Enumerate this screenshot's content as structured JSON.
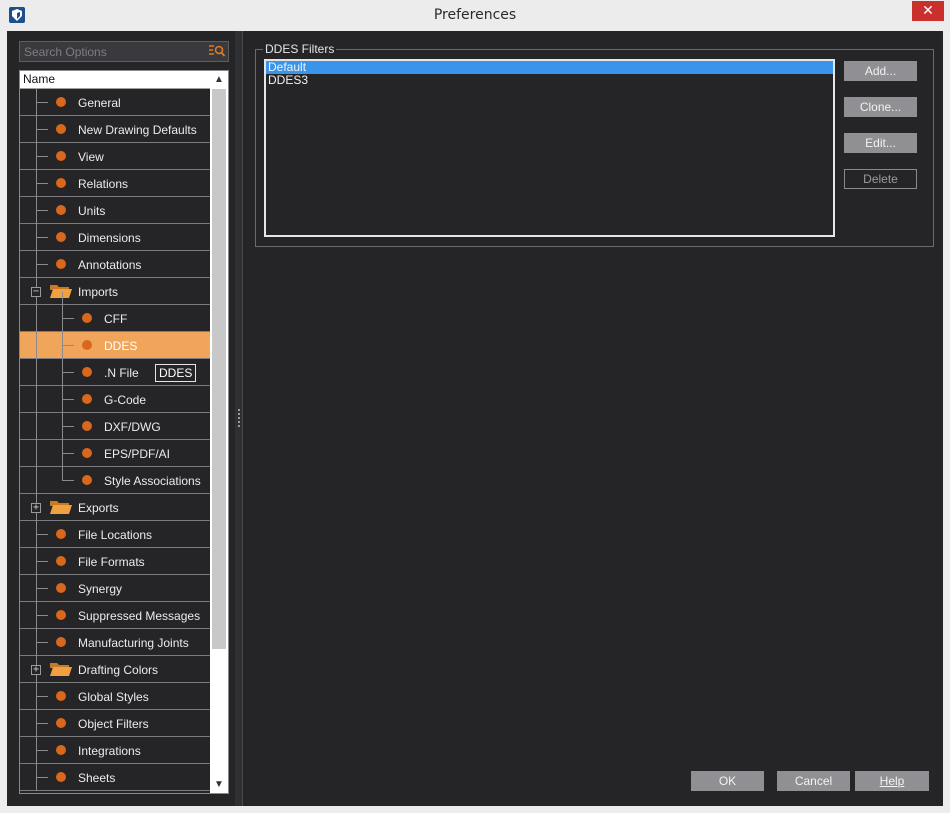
{
  "window": {
    "title": "Preferences",
    "close_glyph": "✕"
  },
  "search": {
    "placeholder": "Search Options",
    "icon": "search-filter-icon"
  },
  "tree": {
    "header": "Name",
    "items": [
      {
        "label": "General",
        "level": 1,
        "kind": "leaf"
      },
      {
        "label": "New Drawing Defaults",
        "level": 1,
        "kind": "leaf"
      },
      {
        "label": "View",
        "level": 1,
        "kind": "leaf"
      },
      {
        "label": "Relations",
        "level": 1,
        "kind": "leaf"
      },
      {
        "label": "Units",
        "level": 1,
        "kind": "leaf"
      },
      {
        "label": "Dimensions",
        "level": 1,
        "kind": "leaf"
      },
      {
        "label": "Annotations",
        "level": 1,
        "kind": "leaf"
      },
      {
        "label": "Imports",
        "level": 1,
        "kind": "folder",
        "expanded": true
      },
      {
        "label": "CFF",
        "level": 2,
        "kind": "leaf"
      },
      {
        "label": "DDES",
        "level": 2,
        "kind": "leaf",
        "selected": true
      },
      {
        "label": ".N File",
        "level": 2,
        "kind": "leaf"
      },
      {
        "label": "G-Code",
        "level": 2,
        "kind": "leaf"
      },
      {
        "label": "DXF/DWG",
        "level": 2,
        "kind": "leaf"
      },
      {
        "label": "EPS/PDF/AI",
        "level": 2,
        "kind": "leaf"
      },
      {
        "label": "Style Associations",
        "level": 2,
        "kind": "leaf",
        "last": true
      },
      {
        "label": "Exports",
        "level": 1,
        "kind": "folder",
        "expanded": false
      },
      {
        "label": "File Locations",
        "level": 1,
        "kind": "leaf"
      },
      {
        "label": "File Formats",
        "level": 1,
        "kind": "leaf"
      },
      {
        "label": "Synergy",
        "level": 1,
        "kind": "leaf"
      },
      {
        "label": "Suppressed Messages",
        "level": 1,
        "kind": "leaf"
      },
      {
        "label": "Manufacturing Joints",
        "level": 1,
        "kind": "leaf"
      },
      {
        "label": "Drafting Colors",
        "level": 1,
        "kind": "folder",
        "expanded": false
      },
      {
        "label": "Global Styles",
        "level": 1,
        "kind": "leaf"
      },
      {
        "label": "Object Filters",
        "level": 1,
        "kind": "leaf"
      },
      {
        "label": "Integrations",
        "level": 1,
        "kind": "leaf"
      },
      {
        "label": "Sheets",
        "level": 1,
        "kind": "leaf"
      }
    ],
    "tooltip": "DDES"
  },
  "ddes_filters": {
    "group_title": "DDES Filters",
    "items": [
      "Default",
      "DDES3"
    ],
    "selected_index": 0,
    "buttons": {
      "add": "Add...",
      "clone": "Clone...",
      "edit": "Edit...",
      "delete": "Delete"
    }
  },
  "footer": {
    "ok": "OK",
    "cancel": "Cancel",
    "help": "Help"
  },
  "colors": {
    "accent_selected": "#f0a55a",
    "list_selection": "#3a94ea",
    "bullet": "#d9671c",
    "folder": "#f0a040"
  }
}
